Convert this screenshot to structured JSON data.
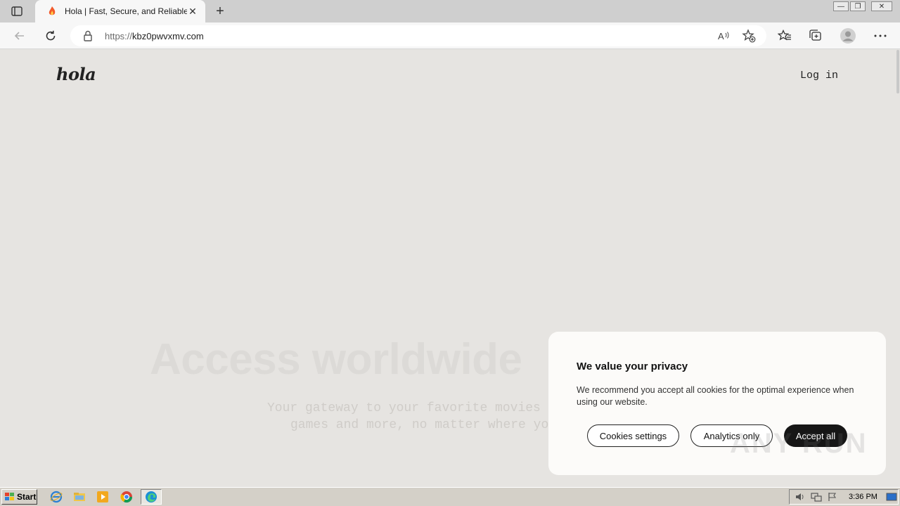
{
  "browser": {
    "tab_title": "Hola | Fast, Secure, and Reliable",
    "tab_close_label": "✕",
    "new_tab_label": "+",
    "url_prefix": "https://",
    "url_host": "kbz0pwvxmv.com",
    "icons": [
      "tab-actions-icon",
      "back-icon",
      "refresh-icon",
      "lock-icon",
      "read-aloud-icon",
      "add-favorite-icon",
      "favorites-icon",
      "collections-icon",
      "profile-icon",
      "more-icon"
    ]
  },
  "window_controls": {
    "minimize": "—",
    "restore": "❐",
    "close": "✕"
  },
  "page": {
    "logo": "hola",
    "login_link": "Log in",
    "hero_heading": "Access worldwide",
    "hero_sub_line1": "Your gateway to your favorite movies",
    "hero_sub_line2": "games and more, no matter where yo"
  },
  "cookie_banner": {
    "title": "We value your privacy",
    "body": "We recommend you accept all cookies for the optimal experience when using our website.",
    "btn_settings": "Cookies settings",
    "btn_analytics": "Analytics only",
    "btn_accept": "Accept all",
    "watermark": "ANY RUN"
  },
  "taskbar": {
    "start_label": "Start",
    "clock": "3:36 PM",
    "pinned": [
      "ie-icon",
      "folder-icon",
      "media-player-icon",
      "chrome-icon",
      "edge-icon"
    ]
  },
  "colors": {
    "page_bg": "#e6e4e1",
    "banner_bg": "#fcfbf9",
    "accept_bg": "#161616"
  }
}
